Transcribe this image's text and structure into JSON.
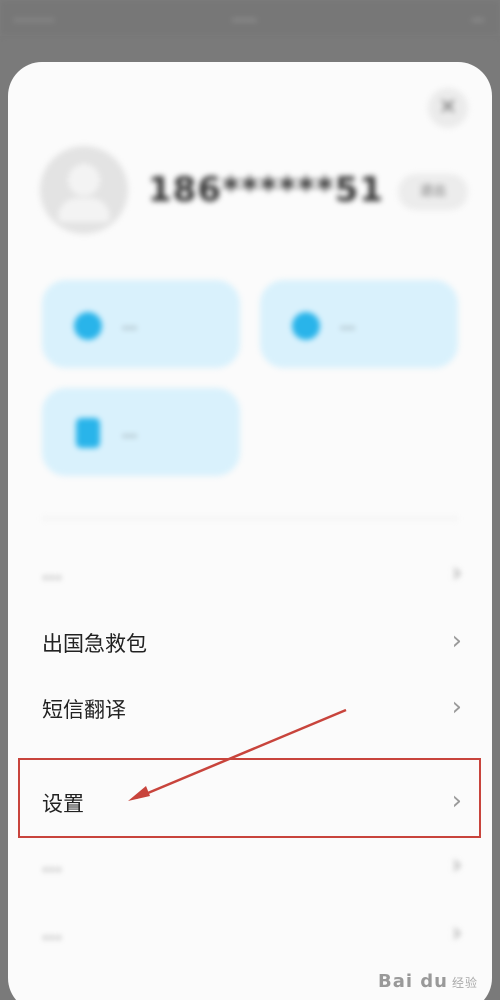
{
  "status_bar": {
    "left_text": "........",
    "mid_text": "......",
    "right_text": "..."
  },
  "dialog": {
    "close_icon": "✕",
    "user": {
      "phone": "186******51",
      "exit_label": "退出"
    },
    "cards": [
      {
        "label": "...",
        "icon": "shield-icon"
      },
      {
        "label": "...",
        "icon": "circle-icon"
      },
      {
        "label": "...",
        "icon": "document-icon"
      }
    ],
    "menu": [
      {
        "label": "...",
        "blurred": true
      },
      {
        "label": "出国急救包",
        "blurred": false
      },
      {
        "label": "短信翻译",
        "blurred": false
      },
      {
        "label": "设置",
        "blurred": false,
        "highlighted": true
      },
      {
        "label": "...",
        "blurred": true
      },
      {
        "label": "...",
        "blurred": true
      }
    ],
    "chevron": "›"
  },
  "annotation": {
    "highlight_color": "#c8443c",
    "arrow_color": "#c8443c"
  },
  "watermark": {
    "brand": "Bai du",
    "sub": "经验"
  }
}
